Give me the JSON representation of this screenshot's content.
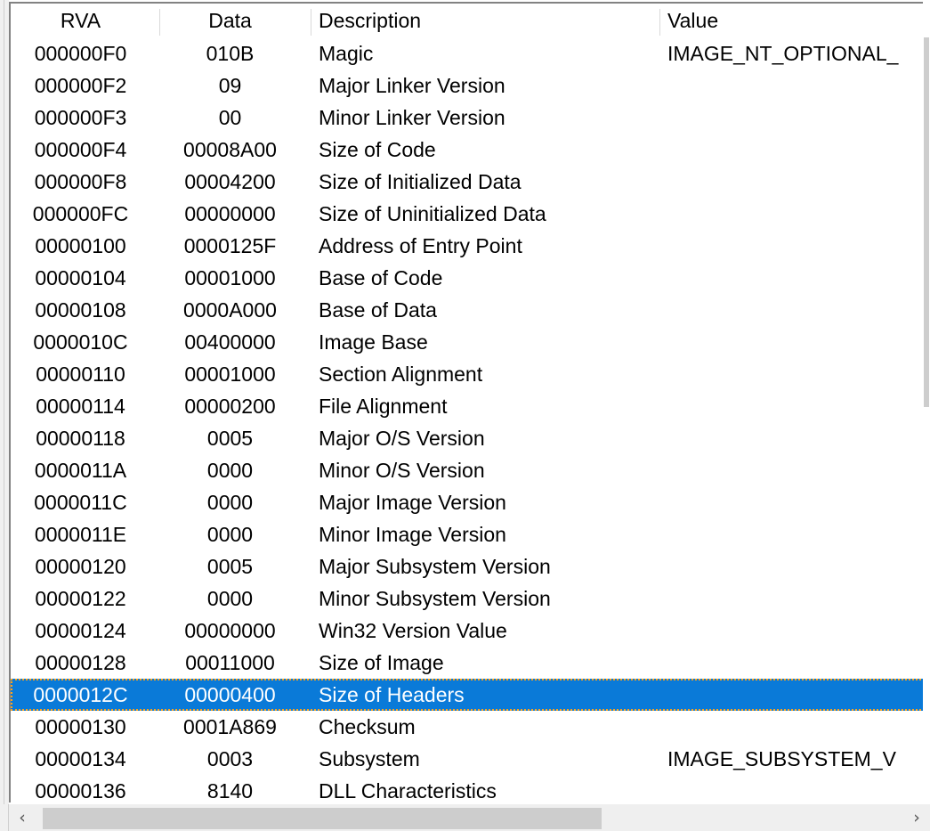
{
  "window": {
    "kind": "pe-optional-header-listview"
  },
  "listview": {
    "columns": [
      {
        "key": "rva",
        "label": "RVA"
      },
      {
        "key": "data",
        "label": "Data"
      },
      {
        "key": "desc",
        "label": "Description"
      },
      {
        "key": "value",
        "label": "Value"
      }
    ],
    "selected_index": 20,
    "selection_color": "#0a7ad8",
    "selection_text_color": "#ffffff",
    "focus_border_color": "#ffa31a",
    "rows": [
      {
        "rva": "000000F0",
        "data": "010B",
        "desc": "Magic",
        "value": "IMAGE_NT_OPTIONAL_"
      },
      {
        "rva": "000000F2",
        "data": "09",
        "desc": "Major Linker Version",
        "value": ""
      },
      {
        "rva": "000000F3",
        "data": "00",
        "desc": "Minor Linker Version",
        "value": ""
      },
      {
        "rva": "000000F4",
        "data": "00008A00",
        "desc": "Size of Code",
        "value": ""
      },
      {
        "rva": "000000F8",
        "data": "00004200",
        "desc": "Size of Initialized Data",
        "value": ""
      },
      {
        "rva": "000000FC",
        "data": "00000000",
        "desc": "Size of Uninitialized Data",
        "value": ""
      },
      {
        "rva": "00000100",
        "data": "0000125F",
        "desc": "Address of Entry Point",
        "value": ""
      },
      {
        "rva": "00000104",
        "data": "00001000",
        "desc": "Base of Code",
        "value": ""
      },
      {
        "rva": "00000108",
        "data": "0000A000",
        "desc": "Base of Data",
        "value": ""
      },
      {
        "rva": "0000010C",
        "data": "00400000",
        "desc": "Image Base",
        "value": ""
      },
      {
        "rva": "00000110",
        "data": "00001000",
        "desc": "Section Alignment",
        "value": ""
      },
      {
        "rva": "00000114",
        "data": "00000200",
        "desc": "File Alignment",
        "value": ""
      },
      {
        "rva": "00000118",
        "data": "0005",
        "desc": "Major O/S Version",
        "value": ""
      },
      {
        "rva": "0000011A",
        "data": "0000",
        "desc": "Minor O/S Version",
        "value": ""
      },
      {
        "rva": "0000011C",
        "data": "0000",
        "desc": "Major Image Version",
        "value": ""
      },
      {
        "rva": "0000011E",
        "data": "0000",
        "desc": "Minor Image Version",
        "value": ""
      },
      {
        "rva": "00000120",
        "data": "0005",
        "desc": "Major Subsystem Version",
        "value": ""
      },
      {
        "rva": "00000122",
        "data": "0000",
        "desc": "Minor Subsystem Version",
        "value": ""
      },
      {
        "rva": "00000124",
        "data": "00000000",
        "desc": "Win32 Version Value",
        "value": ""
      },
      {
        "rva": "00000128",
        "data": "00011000",
        "desc": "Size of Image",
        "value": ""
      },
      {
        "rva": "0000012C",
        "data": "00000400",
        "desc": "Size of Headers",
        "value": ""
      },
      {
        "rva": "00000130",
        "data": "0001A869",
        "desc": "Checksum",
        "value": ""
      },
      {
        "rva": "00000134",
        "data": "0003",
        "desc": "Subsystem",
        "value": "IMAGE_SUBSYSTEM_V"
      },
      {
        "rva": "00000136",
        "data": "8140",
        "desc": "DLL Characteristics",
        "value": ""
      }
    ]
  },
  "scrollbars": {
    "horizontal": {
      "left_arrow": "‹",
      "right_arrow": "›"
    }
  }
}
